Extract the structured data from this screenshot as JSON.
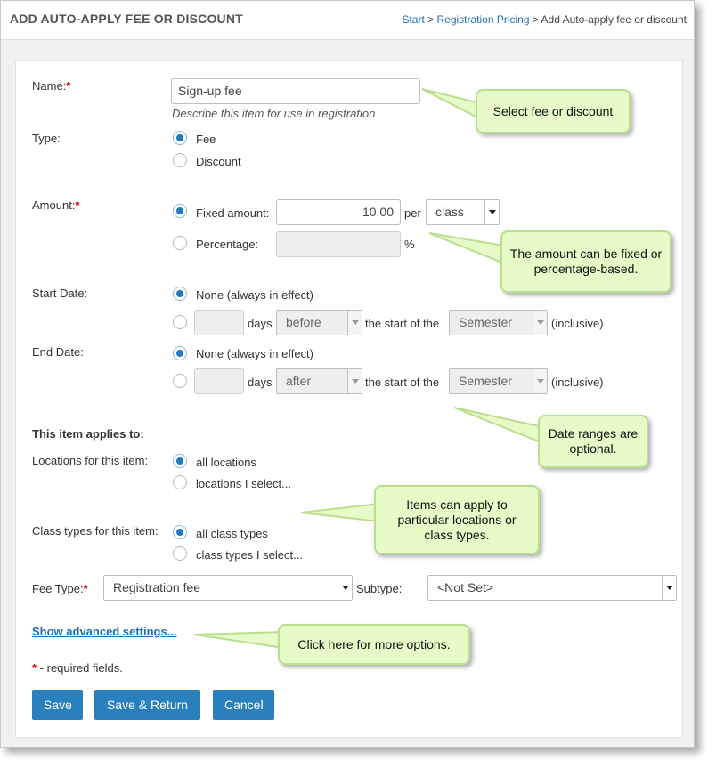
{
  "header": {
    "title": "ADD AUTO-APPLY FEE OR DISCOUNT",
    "breadcrumb": {
      "start": "Start",
      "sep1": " > ",
      "pricing": "Registration Pricing",
      "sep2": " > ",
      "current": "Add Auto-apply fee or discount"
    }
  },
  "form": {
    "name": {
      "label": "Name:",
      "required_mark": "*",
      "value": "Sign-up fee",
      "hint": "Describe this item for use in registration"
    },
    "type": {
      "label": "Type:",
      "options": [
        "Fee",
        "Discount"
      ],
      "selected": "Fee"
    },
    "amount": {
      "label": "Amount:",
      "required_mark": "*",
      "fixed_label": "Fixed amount:",
      "fixed_value": "10.00",
      "per": "per",
      "per_unit": "class",
      "percentage_label": "Percentage:",
      "percentage_value": "",
      "percent_sign": "%"
    },
    "start_date": {
      "label": "Start Date:",
      "none_label": "None (always in effect)",
      "days_value": "",
      "days": "days",
      "relation": "before",
      "the_start_of": "the start of the",
      "period": "Semester",
      "inclusive": "(inclusive)"
    },
    "end_date": {
      "label": "End Date:",
      "none_label": "None (always in effect)",
      "days_value": "",
      "days": "days",
      "relation": "after",
      "the_start_of": "the start of the",
      "period": "Semester",
      "inclusive": "(inclusive)"
    },
    "applies_heading": "This item applies to:",
    "locations": {
      "label": "Locations for this item:",
      "options": [
        "all locations",
        "locations I select..."
      ],
      "selected": "all locations"
    },
    "class_types": {
      "label": "Class types for this item:",
      "options": [
        "all class types",
        "class types I select..."
      ],
      "selected": "all class types"
    },
    "fee_type": {
      "label": "Fee Type:",
      "required_mark": "*",
      "value": "Registration fee"
    },
    "subtype": {
      "label": "Subtype:",
      "value": "<Not Set>"
    },
    "advanced_link": "Show advanced settings...",
    "required_note": {
      "mark": "*",
      "text": " - required fields."
    },
    "buttons": {
      "save": "Save",
      "save_return": "Save & Return",
      "cancel": "Cancel"
    }
  },
  "callouts": {
    "fee_discount": "Select fee or discount",
    "amount": "The amount can be fixed or percentage-based.",
    "dates": "Date ranges are optional.",
    "applies": "Items can apply to particular locations or class types.",
    "advanced": "Click here for more options."
  },
  "colors": {
    "accent": "#2a80bd",
    "link": "#1f6fb5",
    "required": "#cc0000",
    "callout_bg": "#e6fbc8",
    "callout_border": "#b9df8e"
  }
}
